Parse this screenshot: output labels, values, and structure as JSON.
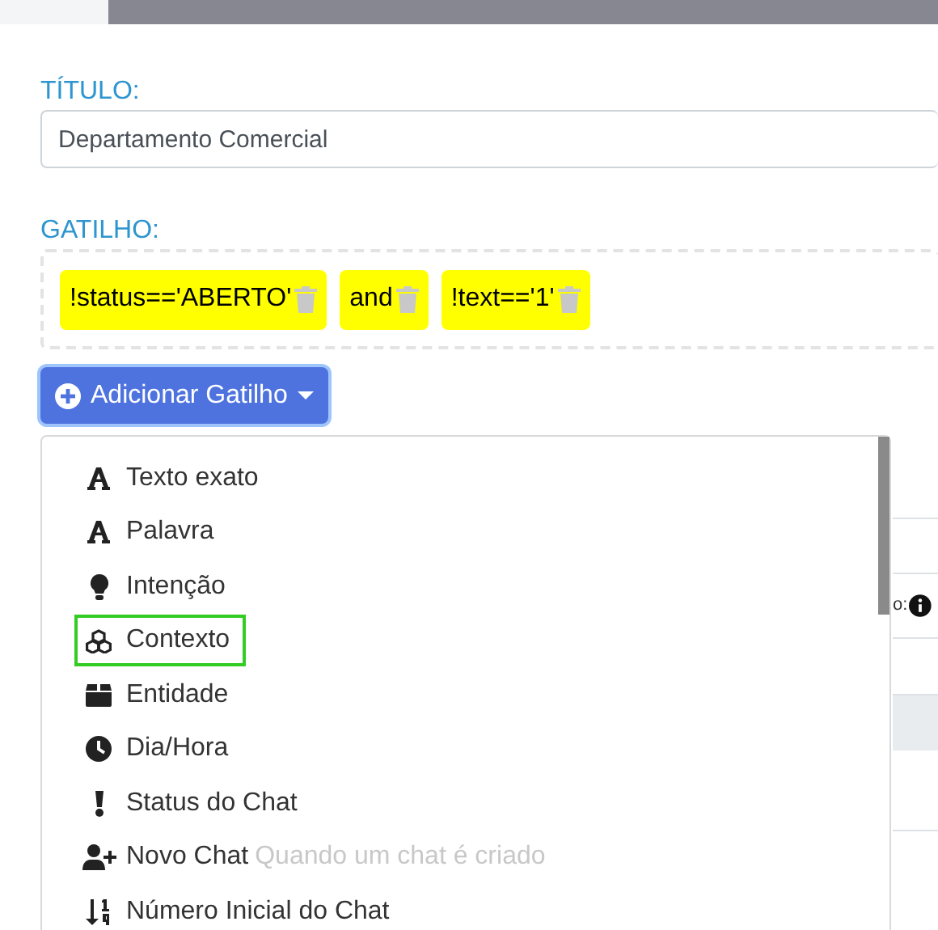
{
  "form": {
    "title_label": "TÍTULO:",
    "title_value": "Departamento Comercial",
    "trigger_label": "GATILHO:",
    "triggers": [
      {
        "text": "!status=='ABERTO'"
      },
      {
        "text": "and"
      },
      {
        "text": "!text=='1'"
      }
    ],
    "add_button": "Adicionar Gatilho"
  },
  "background": {
    "label_fragment": "o:"
  },
  "menu": [
    {
      "kind": "letter",
      "label": "Texto exato",
      "selected": false
    },
    {
      "kind": "letter",
      "label": "Palavra",
      "selected": false
    },
    {
      "kind": "bulb",
      "label": "Intenção",
      "selected": false
    },
    {
      "kind": "cubes",
      "label": "Contexto",
      "selected": true
    },
    {
      "kind": "box",
      "label": "Entidade",
      "selected": false
    },
    {
      "kind": "clock",
      "label": "Dia/Hora",
      "selected": false
    },
    {
      "kind": "exclamation",
      "label": "Status do Chat",
      "selected": false
    },
    {
      "kind": "user-plus",
      "label": "Novo Chat",
      "hint": "Quando um chat é criado",
      "selected": false
    },
    {
      "kind": "sort",
      "label": "Número Inicial do Chat",
      "selected": false
    }
  ]
}
